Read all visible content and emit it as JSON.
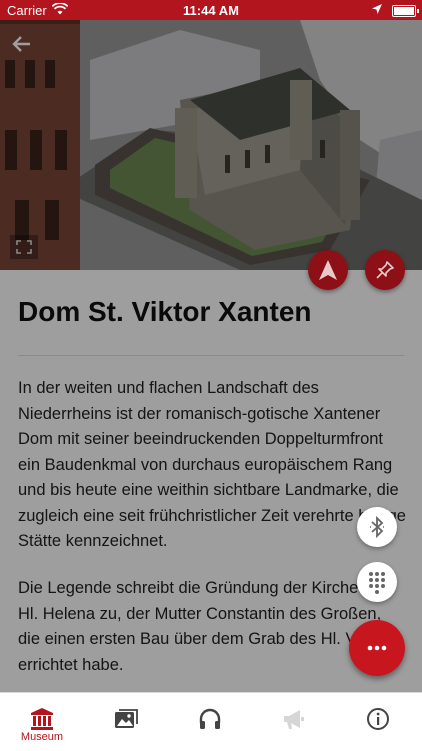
{
  "status_bar": {
    "carrier": "Carrier",
    "time": "11:44 AM"
  },
  "article": {
    "title": "Dom St. Viktor Xanten",
    "paragraphs": [
      "In der weiten und flachen Landschaft des Niederrheins ist der romanisch-gotische Xantener Dom mit seiner beeindruckenden Doppelturmfront ein Baudenkmal von durchaus europäischem Rang und bis heute eine weithin sichtbare Landmarke, die zugleich eine seit frühchristlicher Zeit verehrte heilige Stätte kennzeichnet.",
      "Die Legende schreibt die Gründung der Kirche der Hl. Helena zu, der Mutter Constantin des Großen, die einen ersten Bau über dem Grab des Hl. Viktor errichtet habe."
    ]
  },
  "tabbar": {
    "tabs": [
      {
        "label": "Museum",
        "icon": "museum-icon",
        "active": true
      },
      {
        "label": "",
        "icon": "gallery-icon"
      },
      {
        "label": "",
        "icon": "headphones-icon"
      },
      {
        "label": "",
        "icon": "megaphone-icon",
        "disabled": true
      },
      {
        "label": "",
        "icon": "info-icon"
      }
    ]
  },
  "icons": [
    "back-arrow-icon",
    "fullscreen-icon",
    "navigation-arrow-icon",
    "pin-icon",
    "bluetooth-icon",
    "keypad-icon",
    "more-dots-icon"
  ],
  "colors": {
    "accent": "#b2151e",
    "fab_red": "#c8161f",
    "dark_red": "#8c1016"
  }
}
